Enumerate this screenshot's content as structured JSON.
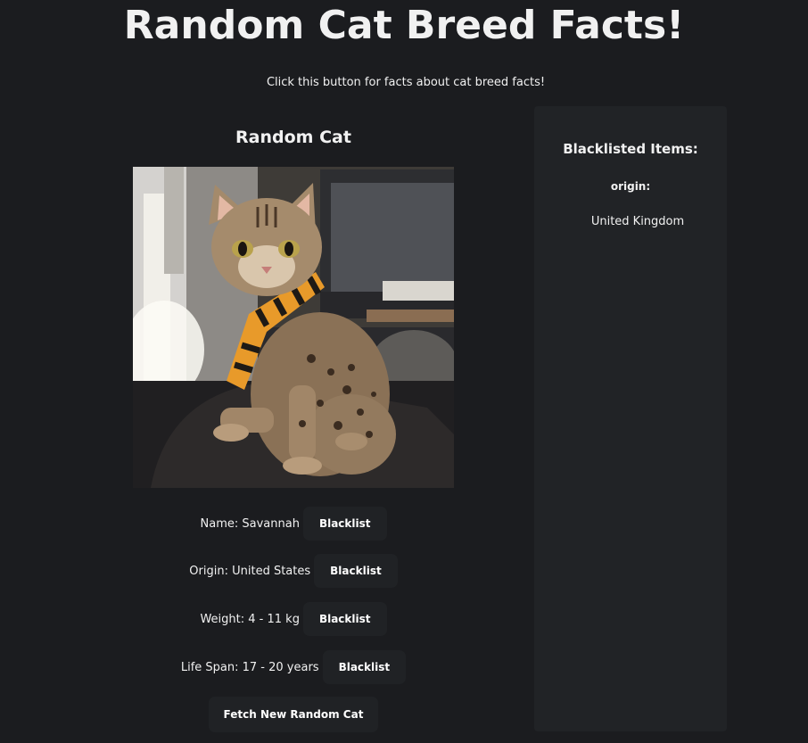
{
  "header": {
    "title": "Random Cat Breed Facts!",
    "subtitle": "Click this button for facts about cat breed facts!"
  },
  "card": {
    "title": "Random Cat",
    "facts": [
      {
        "text": "Name: Savannah",
        "button_label": "Blacklist"
      },
      {
        "text": "Origin: United States",
        "button_label": "Blacklist"
      },
      {
        "text": "Weight: 4 - 11 kg",
        "button_label": "Blacklist"
      },
      {
        "text": "Life Span: 17 - 20 years",
        "button_label": "Blacklist"
      }
    ],
    "fetch_label": "Fetch New Random Cat"
  },
  "blacklist": {
    "title": "Blacklisted Items:",
    "groups": [
      {
        "key": "origin:",
        "values": [
          "United Kingdom"
        ]
      }
    ]
  },
  "colors": {
    "background": "#1b1c1f",
    "panel": "#212326",
    "button": "#202225",
    "text": "#f1f1f1"
  }
}
